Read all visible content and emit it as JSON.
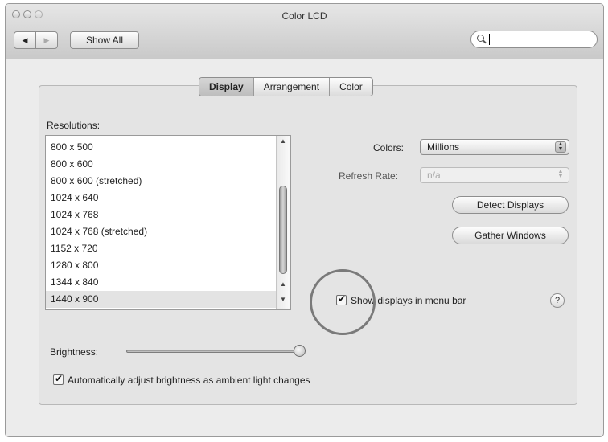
{
  "window": {
    "title": "Color LCD"
  },
  "toolbar": {
    "show_all_label": "Show All",
    "back_label": "◀",
    "forward_label": "▶",
    "search_value": ""
  },
  "tabs": [
    {
      "label": "Display",
      "active": true
    },
    {
      "label": "Arrangement",
      "active": false
    },
    {
      "label": "Color",
      "active": false
    }
  ],
  "resolutions": {
    "label": "Resolutions:",
    "items": [
      "800 x 500",
      "800 x 600",
      "800 x 600 (stretched)",
      "1024 x 640",
      "1024 x 768",
      "1024 x 768 (stretched)",
      "1152 x 720",
      "1280 x 800",
      "1344 x 840",
      "1440 x 900"
    ],
    "selected": "1440 x 900"
  },
  "colors": {
    "label": "Colors:",
    "value": "Millions"
  },
  "refresh_rate": {
    "label": "Refresh Rate:",
    "value": "n/a"
  },
  "buttons": {
    "detect_displays": "Detect Displays",
    "gather_windows": "Gather Windows"
  },
  "show_displays_menu": {
    "label": "Show displays in menu bar",
    "checked": true
  },
  "help_label": "?",
  "brightness": {
    "label": "Brightness:",
    "level": 0.98
  },
  "auto_brightness": {
    "label": "Automatically adjust brightness as ambient light changes",
    "checked": true
  }
}
